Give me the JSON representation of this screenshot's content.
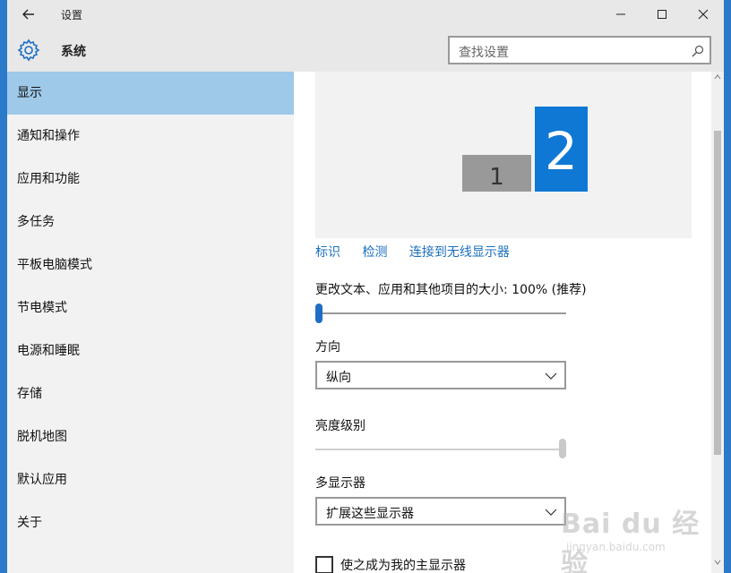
{
  "window": {
    "title": "设置"
  },
  "header": {
    "app_title": "系统",
    "search_placeholder": "查找设置"
  },
  "sidebar": {
    "items": [
      {
        "label": "显示",
        "active": true
      },
      {
        "label": "通知和操作"
      },
      {
        "label": "应用和功能"
      },
      {
        "label": "多任务"
      },
      {
        "label": "平板电脑模式"
      },
      {
        "label": "节电模式"
      },
      {
        "label": "电源和睡眠"
      },
      {
        "label": "存储"
      },
      {
        "label": "脱机地图"
      },
      {
        "label": "默认应用"
      },
      {
        "label": "关于"
      }
    ]
  },
  "display": {
    "monitors": [
      "1",
      "2"
    ],
    "links": [
      "标识",
      "检测",
      "连接到无线显示器"
    ],
    "scale_label": "更改文本、应用和其他项目的大小: 100% (推荐)",
    "scale_slider_value": 0,
    "orientation_label": "方向",
    "orientation_value": "纵向",
    "brightness_label": "亮度级别",
    "brightness_value": 1.0,
    "multi_display_label": "多显示器",
    "multi_display_value": "扩展这些显示器",
    "main_display_checkbox": "使之成为我的主显示器",
    "main_display_checked": false
  },
  "watermark": {
    "main": "Bai du 经验",
    "sub": "jingyan.baidu.com"
  },
  "colors": {
    "accent": "#1f6ec4",
    "active_nav": "#9ec9e9",
    "link": "#1a6fbd",
    "monitor_selected": "#0f78d4"
  }
}
